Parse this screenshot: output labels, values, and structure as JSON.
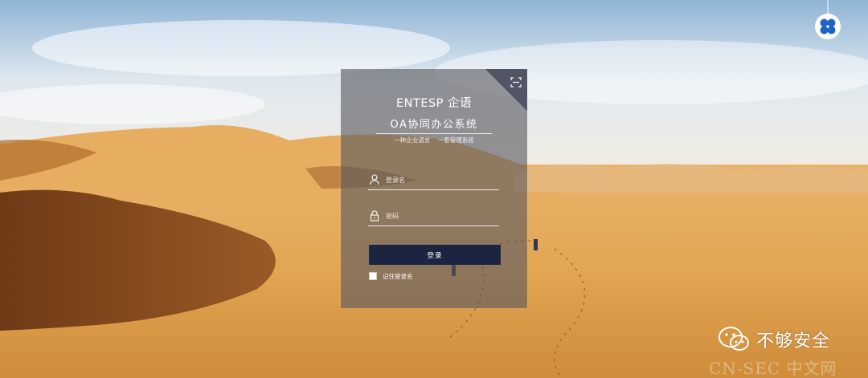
{
  "login": {
    "brand": "ENTESP 企语",
    "system_name": "OA协同办公系统",
    "slogan": "一种企业语言    一套管理系统",
    "username_placeholder": "登录名",
    "password_placeholder": "密码",
    "login_button": "登录",
    "remember_label": "记住登录名"
  },
  "watermark": {
    "account": "不够安全",
    "site": "CN-SEC 中文网"
  },
  "colors": {
    "panel": "#58585f",
    "button": "#1b2541",
    "accent_icon": "#1d63c6"
  },
  "icons": {
    "qr": "qr-scan-icon",
    "user": "user-icon",
    "lock": "lock-icon",
    "top": "four-petal-logo-icon",
    "wechat": "wechat-icon"
  }
}
